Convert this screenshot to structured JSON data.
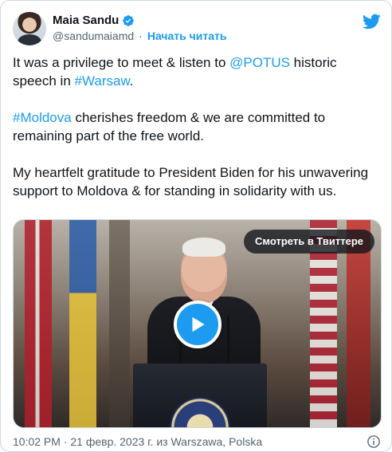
{
  "author": {
    "name": "Maia Sandu",
    "handle": "@sandumaiamd",
    "separator": "·",
    "follow_label": "Начать читать"
  },
  "tweet": {
    "paragraphs": [
      {
        "parts": [
          {
            "text": "It was a privilege to meet & listen to ",
            "link": false
          },
          {
            "text": "@POTUS",
            "link": true
          },
          {
            "text": " historic speech in ",
            "link": false
          },
          {
            "text": "#Warsaw",
            "link": true
          },
          {
            "text": ".",
            "link": false
          }
        ]
      },
      {
        "parts": [
          {
            "text": "#Moldova",
            "link": true
          },
          {
            "text": " cherishes freedom & we are committed to remaining part of the free world.",
            "link": false
          }
        ]
      },
      {
        "parts": [
          {
            "text": "My heartfelt gratitude to President Biden for his unwavering support to Moldova & for standing in solidarity with us.",
            "link": false
          }
        ]
      }
    ]
  },
  "media": {
    "watch_label": "Смотреть в Твиттере"
  },
  "footer": {
    "timestamp": "10:02 PM · 21 февр. 2023 г. из Warszawa, Polska"
  },
  "colors": {
    "accent": "#1d9bf0",
    "text": "#0f1419",
    "secondary": "#536471",
    "border": "#cfd9de"
  },
  "icons": {
    "verified": "verified-badge-icon",
    "logo": "twitter-bird-icon",
    "play": "play-icon",
    "info": "info-icon"
  }
}
